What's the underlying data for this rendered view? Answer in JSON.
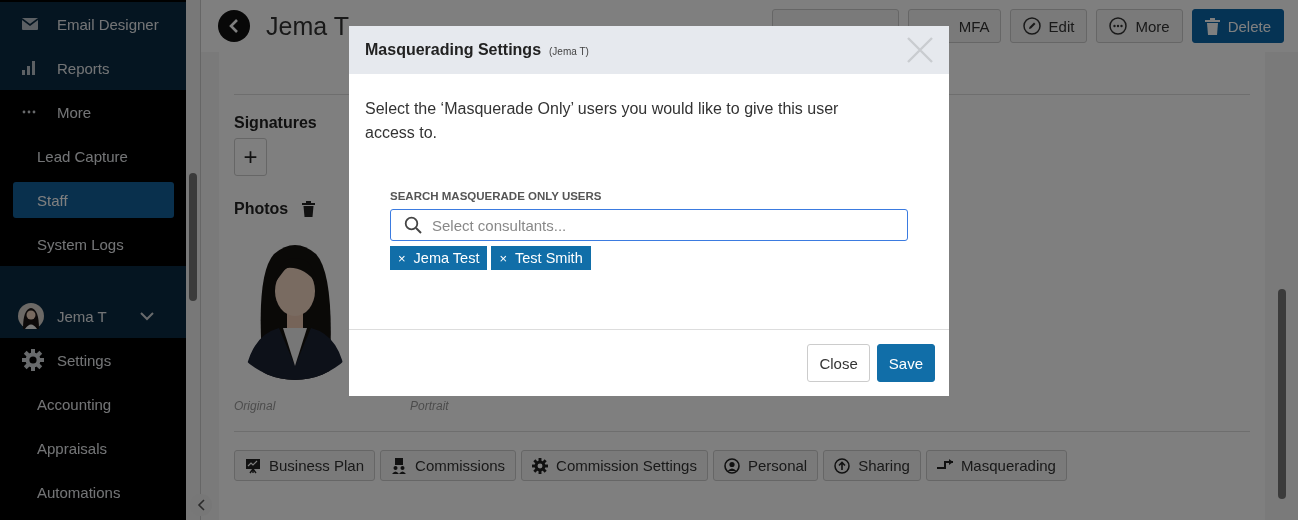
{
  "sidebar": {
    "items": [
      {
        "kind": "nav",
        "label": "Email Designer",
        "expanded": false
      },
      {
        "kind": "nav",
        "label": "Reports",
        "expanded": false
      },
      {
        "kind": "nav",
        "label": "More",
        "expanded": true
      },
      {
        "kind": "sub",
        "label": "Lead Capture",
        "selected": false
      },
      {
        "kind": "sub",
        "label": "Staff",
        "selected": true
      },
      {
        "kind": "sub",
        "label": "System Logs",
        "selected": false
      },
      {
        "kind": "user",
        "label": "Jema T",
        "expanded": false
      },
      {
        "kind": "nav",
        "label": "Settings",
        "expanded": true
      },
      {
        "kind": "sub",
        "label": "Accounting",
        "selected": false
      },
      {
        "kind": "sub",
        "label": "Appraisals",
        "selected": false
      },
      {
        "kind": "sub",
        "label": "Automations",
        "selected": false
      }
    ]
  },
  "header": {
    "title": "Jema T",
    "actions": [
      {
        "kind": "covered"
      },
      {
        "kind": "covered",
        "label": "MFA"
      },
      {
        "kind": "edit",
        "label": "Edit"
      },
      {
        "kind": "more",
        "label": "More"
      },
      {
        "kind": "danger",
        "label": "Delete"
      }
    ]
  },
  "signatures": {
    "title": "Signatures",
    "add_label": "+"
  },
  "photos": {
    "title": "Photos",
    "items": [
      {
        "kind": "picture",
        "caption": "Original"
      },
      {
        "caption": "Portrait"
      }
    ]
  },
  "tabs": [
    {
      "label": "Business Plan"
    },
    {
      "label": "Commissions"
    },
    {
      "label": "Commission Settings"
    },
    {
      "label": "Personal"
    },
    {
      "label": "Sharing"
    },
    {
      "label": "Masquerading"
    }
  ],
  "modal": {
    "title": "Masquerading Settings",
    "subtitle": "(Jema T)",
    "description": "Select the ‘Masquerade Only’ users you would like to give this user access to.",
    "field_label": "SEARCH MASQUERADE ONLY USERS",
    "placeholder": "Select consultants...",
    "tags": [
      {
        "remove": "×",
        "label": "Jema Test"
      },
      {
        "remove": "×",
        "label": "Test Smith"
      }
    ],
    "buttons": [
      {
        "kind": "secondary",
        "label": "Close"
      },
      {
        "kind": "primary",
        "label": "Save"
      }
    ]
  }
}
